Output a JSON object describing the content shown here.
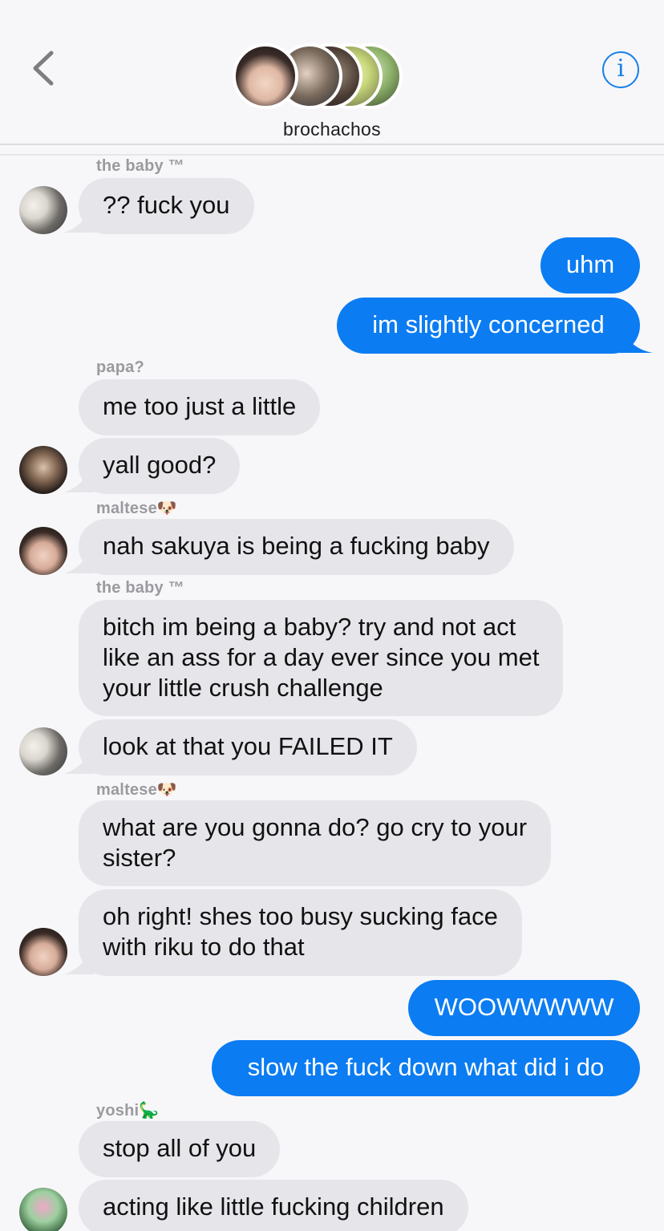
{
  "header": {
    "group_name": "brochachos",
    "back_icon": "chevron-left-icon",
    "info_icon": "info-icon",
    "info_glyph": "i",
    "accent_color": "#0b7cf2"
  },
  "messages": [
    {
      "sender": "the baby ™",
      "text": "?? fuck you"
    },
    {
      "text": "uhm"
    },
    {
      "text": "im slightly concerned"
    },
    {
      "sender": "papa?",
      "text": "me too just a little"
    },
    {
      "text": "yall good?"
    },
    {
      "sender": "maltese🐶",
      "text": "nah sakuya is being a fucking baby"
    },
    {
      "sender": "the baby ™",
      "text": "bitch im being a baby? try and not act like an ass for a day ever since you met your little crush challenge",
      "lines": [
        "bitch im being a baby? try and not act",
        "like an ass for a day ever since you met",
        "your little crush challenge"
      ]
    },
    {
      "text": "look at that you FAILED IT"
    },
    {
      "sender": "maltese🐶",
      "text": "what are you gonna do? go cry to your sister?",
      "lines": [
        "what are you gonna do? go cry to your",
        "sister?"
      ]
    },
    {
      "text": "oh right! shes too busy sucking face with riku to do that",
      "lines": [
        "oh right! shes too busy sucking face",
        "with riku to do that"
      ]
    },
    {
      "text": "WOOWWWWW"
    },
    {
      "text": "slow the fuck down what did i do"
    },
    {
      "sender": "yoshi🦕",
      "text": "stop all of you"
    },
    {
      "text": "acting like little fucking children"
    }
  ]
}
